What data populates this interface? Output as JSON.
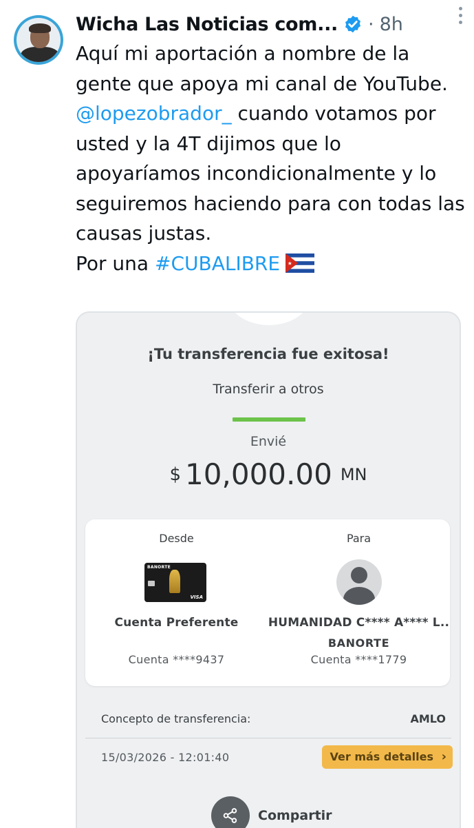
{
  "tweet": {
    "author_name": "Wicha Las Noticias com...",
    "separator": "·",
    "time": "8h",
    "text_before_mention": "Aquí mi aportación a nombre de la gente que apoya mi canal de YouTube. ",
    "mention": "@lopezobrador_",
    "text_after_mention": "  cuando votamos por usted y la 4T dijimos que lo apoyaríamos incondicionalmente y lo seguiremos haciendo para con todas las causas justas.",
    "line_prefix": "Por una ",
    "hashtag": "#CUBALIBRE",
    "flag_icon": "cuba-flag-icon",
    "link_color": "#1d9bf0"
  },
  "receipt": {
    "title": "¡Tu transferencia fue exitosa!",
    "subtitle": "Transferir a otros",
    "accent_color": "#6cc24a",
    "sent_label": "Envié",
    "currency_symbol": "$",
    "amount": "10,000.00",
    "currency_code": "MN",
    "from": {
      "label": "Desde",
      "card_brand": "BANORTE",
      "card_network": "VISA",
      "account_name": "Cuenta Preferente",
      "account_number": "Cuenta ****9437"
    },
    "to": {
      "label": "Para",
      "recipient_name": "HUMANIDAD C**** A**** L..",
      "bank": "BANORTE",
      "account_number": "Cuenta ****1779"
    },
    "concept_label": "Concepto de transferencia:",
    "concept_value": "AMLO",
    "datetime": "15/03/2026 - 12:01:40",
    "details_button": "Ver más detalles",
    "details_button_color": "#f2b94a",
    "share_label": "Compartir"
  }
}
